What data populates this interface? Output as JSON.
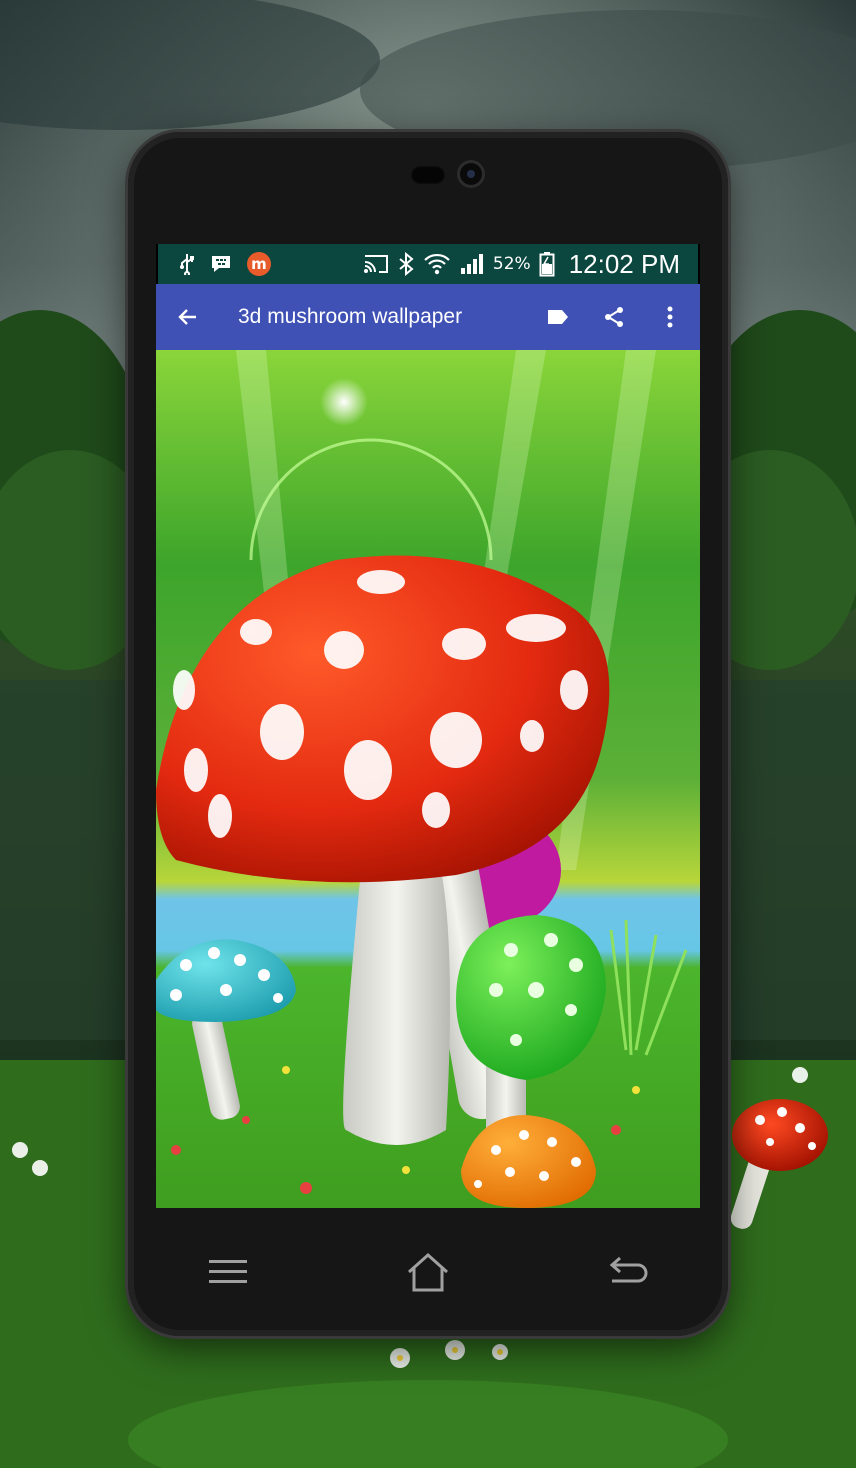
{
  "status_bar": {
    "left_icons": [
      "usb-icon",
      "bbm-icon",
      "mobizen-icon"
    ],
    "right_icons": [
      "cast-icon",
      "bluetooth-icon",
      "wifi-icon",
      "signal-icon",
      "battery-icon"
    ],
    "battery_percent": "52%",
    "time": "12:02 PM"
  },
  "app_bar": {
    "title": "3d mushroom wallpaper",
    "color": "#3f51b5",
    "actions": [
      "label-icon",
      "share-icon",
      "more-vert-icon"
    ]
  },
  "nav_bar": {
    "buttons": [
      "menu-icon",
      "home-icon",
      "back-icon"
    ]
  }
}
